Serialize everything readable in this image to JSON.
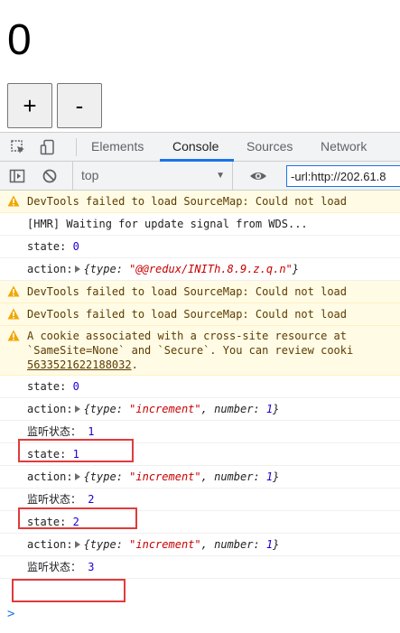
{
  "app": {
    "counter_value": "0",
    "increment_label": "+",
    "decrement_label": "-"
  },
  "devtools": {
    "tabs": [
      "Elements",
      "Console",
      "Sources",
      "Network"
    ],
    "active_tab": "Console",
    "context": "top",
    "filter_value": "-url:http://202.61.8",
    "icons": {
      "inspect": "inspect-element-icon",
      "device": "device-toolbar-icon",
      "sidebar": "show-sidebar-icon",
      "clear": "clear-console-icon",
      "eye": "live-expression-eye-icon",
      "warning": "warning-icon",
      "prompt": "console-prompt-icon"
    },
    "colors": {
      "accent": "#1a73e8",
      "warning_bg": "#fffbe5",
      "warning_icon": "#f2a600",
      "highlight": "#e03b3b",
      "number": "#1c00cf",
      "string": "#c80000"
    }
  },
  "console": {
    "warn_sourcemap": "DevTools failed to load SourceMap: Could not load",
    "hmr": "[HMR] Waiting for update signal from WDS...",
    "state_label": "state:",
    "action_label": "action:",
    "obj_open": "{type: ",
    "obj_type_key": "type: ",
    "number_key": ", number: ",
    "obj_close": "}",
    "init_type": "\"@@redux/INITh.8.9.z.q.n\"",
    "increment_type": "\"increment\"",
    "cookie_line1": "A cookie associated with a cross-site resource at",
    "cookie_line2": "`SameSite=None` and `Secure`. You can review cooki",
    "cookie_link": "5633521622188032",
    "cookie_link_suffix": ".",
    "listen_label": "监听状态：",
    "values": {
      "state_0": "0",
      "state_1": "1",
      "state_2": "2",
      "listen_1": "1",
      "listen_2": "2",
      "listen_3": "3",
      "number_1": "1"
    },
    "prompt_symbol": ">"
  }
}
